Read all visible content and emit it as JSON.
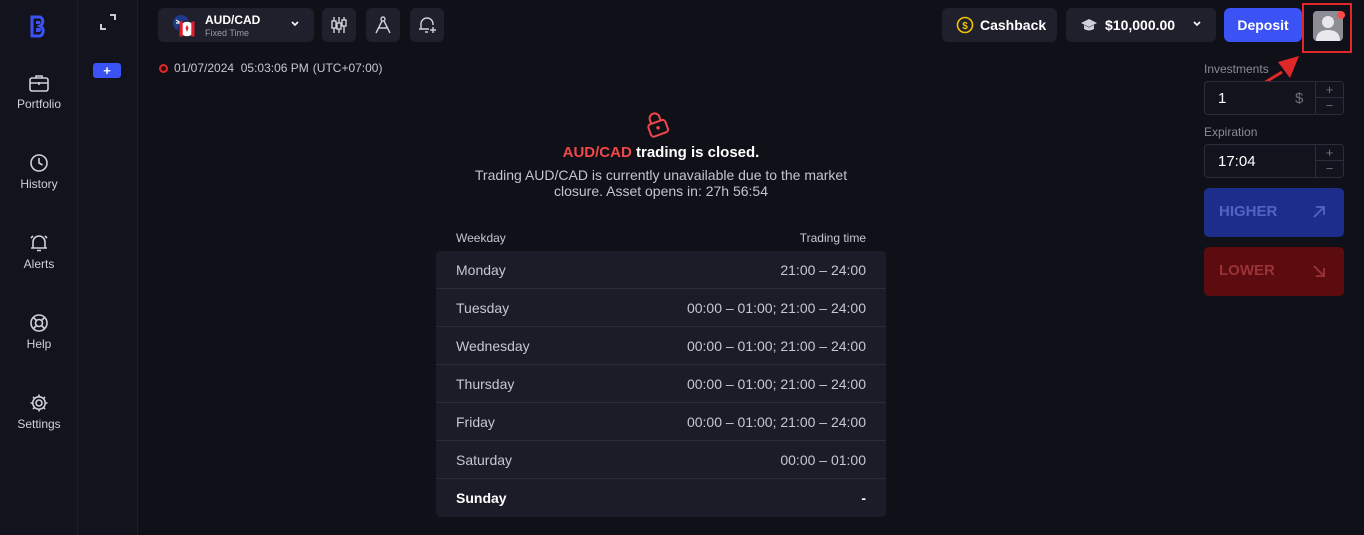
{
  "sidebar": {
    "items": [
      {
        "label": "Portfolio",
        "icon": "briefcase-icon"
      },
      {
        "label": "History",
        "icon": "history-icon"
      },
      {
        "label": "Alerts",
        "icon": "bell-icon"
      },
      {
        "label": "Help",
        "icon": "lifebuoy-icon"
      },
      {
        "label": "Settings",
        "icon": "gear-icon"
      }
    ]
  },
  "secondary": {
    "add_label": "+"
  },
  "topbar": {
    "asset": {
      "name": "AUD/CAD",
      "mode": "Fixed Time"
    },
    "cashback_label": "Cashback",
    "balance": "$10,000.00",
    "deposit_label": "Deposit"
  },
  "timestamp": {
    "datetime": "01/07/2024  05:03:06 PM",
    "timezone": "(UTC+07:00)"
  },
  "notice": {
    "asset": "AUD/CAD",
    "title_suffix": " trading is closed.",
    "description": "Trading AUD/CAD is currently unavailable due to the market closure. Asset opens in: 27h 56:54"
  },
  "schedule": {
    "headers": {
      "weekday": "Weekday",
      "time": "Trading time"
    },
    "rows": [
      {
        "day": "Monday",
        "time": "21:00 – 24:00"
      },
      {
        "day": "Tuesday",
        "time": "00:00 – 01:00; 21:00 – 24:00"
      },
      {
        "day": "Wednesday",
        "time": "00:00 – 01:00; 21:00 – 24:00"
      },
      {
        "day": "Thursday",
        "time": "00:00 – 01:00; 21:00 – 24:00"
      },
      {
        "day": "Friday",
        "time": "00:00 – 01:00; 21:00 – 24:00"
      },
      {
        "day": "Saturday",
        "time": "00:00 – 01:00"
      },
      {
        "day": "Sunday",
        "time": "-"
      }
    ]
  },
  "trade": {
    "investments_label": "Investments",
    "investment_value": "1",
    "currency": "$",
    "expiration_label": "Expiration",
    "expiration_value": "17:04",
    "plus": "+",
    "minus": "−",
    "higher_label": "HIGHER",
    "lower_label": "LOWER"
  },
  "colors": {
    "accent": "#3b52f5",
    "danger": "#f04848",
    "higher": "#1d2e8a",
    "lower": "#5c0c0f"
  }
}
